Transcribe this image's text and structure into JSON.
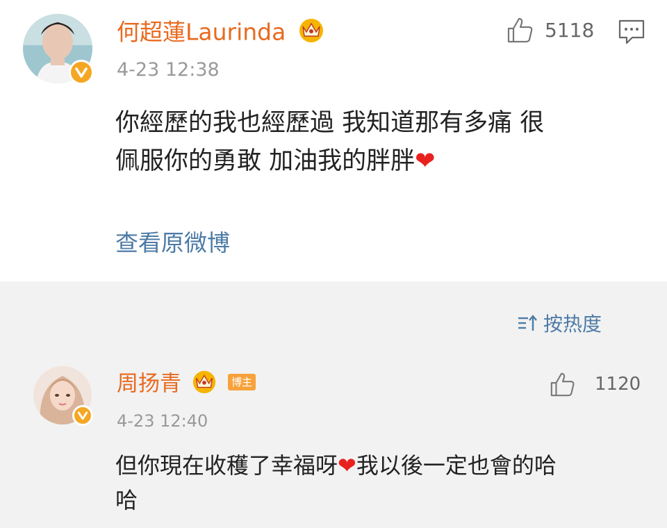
{
  "post": {
    "author": "何超蓮Laurinda",
    "time": "4-23 12:38",
    "likes": "5118",
    "text_line1": "你經歷的我也經歷過 我知道那有多痛 很",
    "text_line2": "佩服你的勇敢 加油我的胖胖",
    "view_original": "查看原微博"
  },
  "sort": {
    "label": "按热度"
  },
  "comments": [
    {
      "author": "周扬青",
      "tag": "博主",
      "time": "4-23 12:40",
      "likes": "1120",
      "text_part1": "但你現在收穫了幸福呀",
      "text_part2": "我以後一定也會的哈",
      "text_line2": "哈"
    }
  ],
  "colors": {
    "name": "#e86a1f",
    "link": "#4d7ba6",
    "heart": "#e8211f",
    "badge": "#f5a623",
    "comments_bg": "#f2f2f2"
  }
}
